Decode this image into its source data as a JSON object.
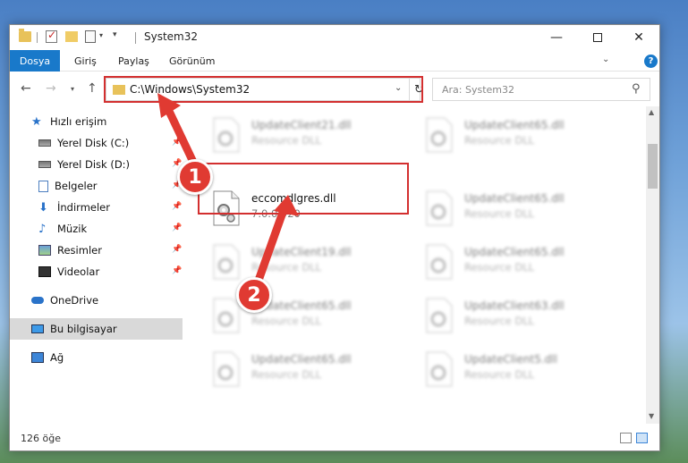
{
  "window": {
    "title": "System32",
    "min_glyph": "—",
    "close_glyph": "✕"
  },
  "ribbon": {
    "file": "Dosya",
    "home": "Giriş",
    "share": "Paylaş",
    "view": "Görünüm",
    "help_glyph": "?"
  },
  "address": {
    "path": "C:\\Windows\\System32",
    "search_placeholder": "Ara: System32"
  },
  "nav": {
    "quick_access": "Hızlı erişim",
    "items": [
      {
        "label": "Yerel Disk (C:)",
        "icon": "disk-icon"
      },
      {
        "label": "Yerel Disk (D:)",
        "icon": "disk-icon"
      },
      {
        "label": "Belgeler",
        "icon": "documents-icon"
      },
      {
        "label": "İndirmeler",
        "icon": "downloads-icon"
      },
      {
        "label": "Müzik",
        "icon": "music-icon"
      },
      {
        "label": "Resimler",
        "icon": "pictures-icon"
      },
      {
        "label": "Videolar",
        "icon": "videos-icon"
      }
    ],
    "onedrive": "OneDrive",
    "this_pc": "Bu bilgisayar",
    "network": "Ağ"
  },
  "files": {
    "highlighted": {
      "name": "eccomdlgres.dll",
      "version": "7.0.0.920"
    },
    "blurred": [
      {
        "name": "UpdateClient21.dll",
        "type": "Resource DLL"
      },
      {
        "name": "UpdateClient65.dll",
        "type": "Resource DLL"
      },
      {
        "name": "UpdateClient65.dll",
        "type": "Resource DLL"
      },
      {
        "name": "UpdateClient19.dll",
        "type": "Resource DLL"
      },
      {
        "name": "UpdateClient65.dll",
        "type": "Resource DLL"
      },
      {
        "name": "UpdateClient65.dll",
        "type": "Resource DLL"
      },
      {
        "name": "UpdateClient63.dll",
        "type": "Resource DLL"
      },
      {
        "name": "UpdateClient65.dll",
        "type": "Resource DLL"
      },
      {
        "name": "UpdateClient5.dll",
        "type": "Resource DLL"
      }
    ]
  },
  "status": {
    "count": "126 öğe"
  },
  "annotations": {
    "step1": "1",
    "step2": "2",
    "color": "#e03a32"
  }
}
